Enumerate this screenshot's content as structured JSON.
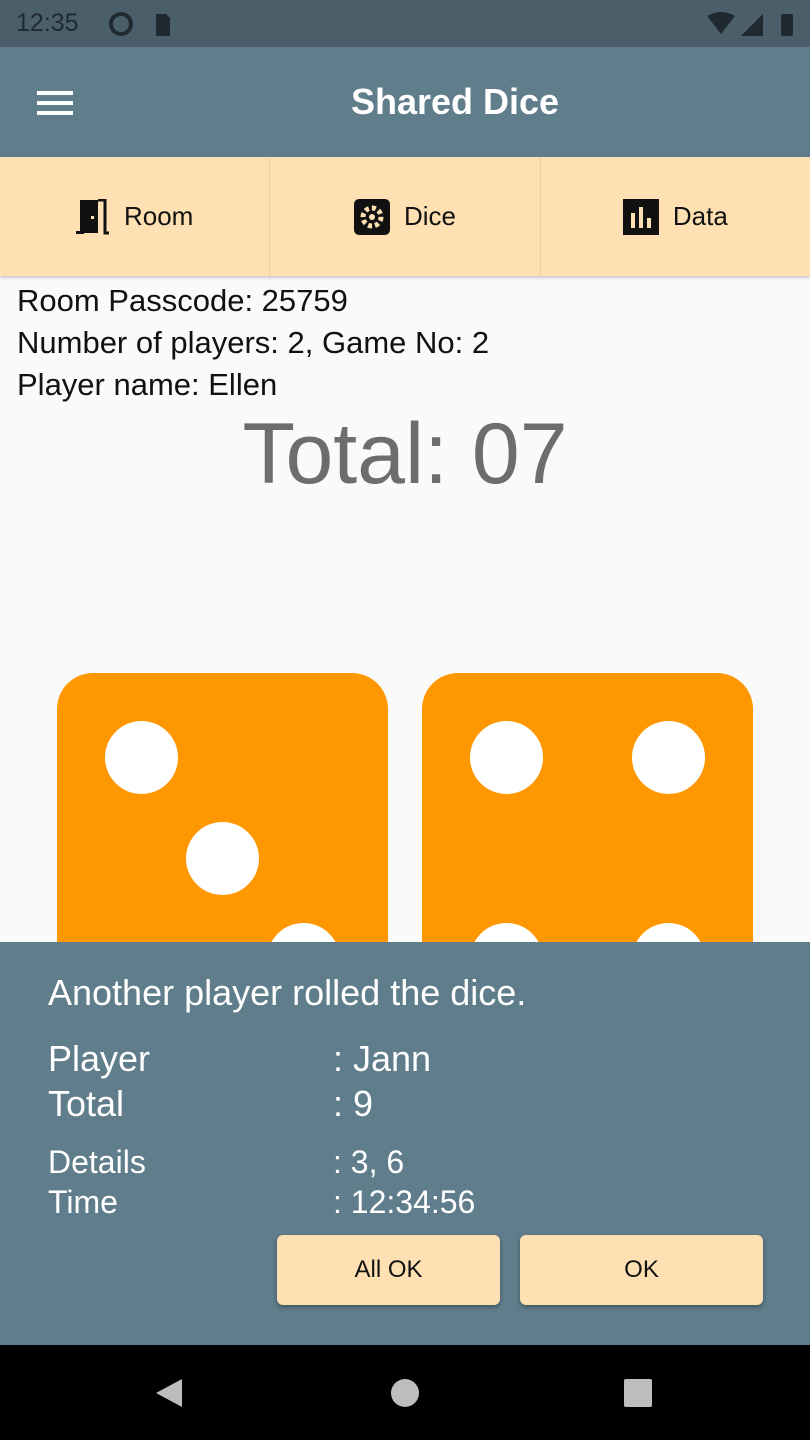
{
  "status": {
    "time": "12:35"
  },
  "appbar": {
    "title": "Shared Dice"
  },
  "tabs": [
    {
      "label": "Room",
      "icon": "door-icon"
    },
    {
      "label": "Dice",
      "icon": "gear-icon"
    },
    {
      "label": "Data",
      "icon": "bar-chart-icon"
    }
  ],
  "info": {
    "passcode": "Room Passcode: 25759",
    "players": "Number of players: 2,  Game No: 2",
    "player_name": "Player name: Ellen"
  },
  "total": "Total: 07",
  "dice": {
    "values": [
      3,
      4
    ],
    "color": "#ff9800"
  },
  "dialog": {
    "message": "Another player rolled the dice.",
    "rows": [
      {
        "label": "Player",
        "value": ": Jann"
      },
      {
        "label": "Total",
        "value": ": 9"
      },
      {
        "label": "Details",
        "value": ": 3, 6"
      },
      {
        "label": "Time",
        "value": ": 12:34:56"
      }
    ],
    "all_ok": "All OK",
    "ok": "OK"
  }
}
